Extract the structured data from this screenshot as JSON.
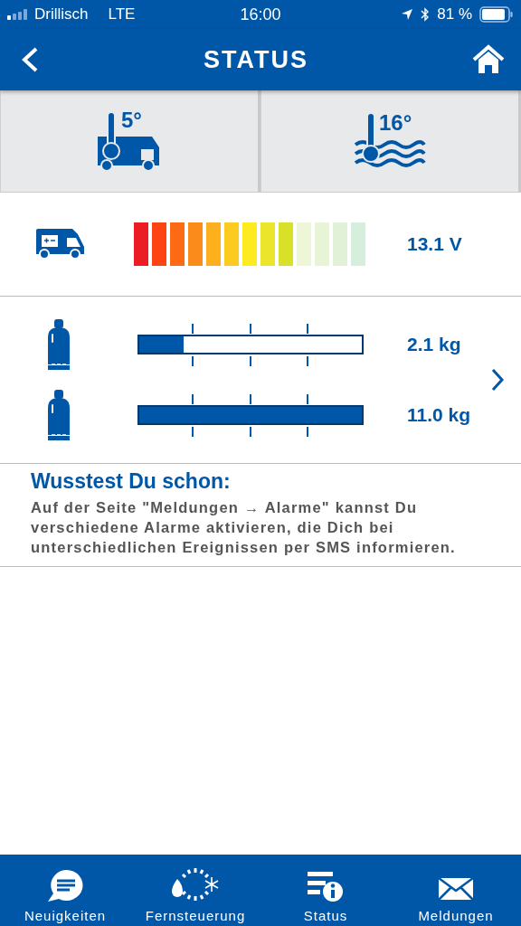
{
  "status_bar": {
    "carrier": "Drillisch",
    "network": "LTE",
    "time": "16:00",
    "battery": "81 %"
  },
  "nav": {
    "title": "STATUS"
  },
  "temperatures": [
    {
      "kind": "vehicle",
      "value": "5°"
    },
    {
      "kind": "water",
      "value": "16°"
    }
  ],
  "battery_row": {
    "level": 0.69,
    "reading": "13.1 V"
  },
  "gas_bottles": [
    {
      "level": 0.2,
      "reading": "2.1 kg"
    },
    {
      "level": 1.0,
      "reading": "11.0 kg"
    }
  ],
  "tip": {
    "title": "Wusstest Du schon:",
    "text": "Auf der Seite \"Meldungen → Alarme\" kannst Du verschiedene Alarme aktivieren, die Dich bei unterschiedlichen Ereignissen per SMS informieren."
  },
  "tab_bar": [
    {
      "kind": "news",
      "label": "Neuigkeiten"
    },
    {
      "kind": "remote",
      "label": "Fernsteuerung"
    },
    {
      "kind": "status",
      "label": "Status"
    },
    {
      "kind": "messages",
      "label": "Meldungen"
    }
  ]
}
